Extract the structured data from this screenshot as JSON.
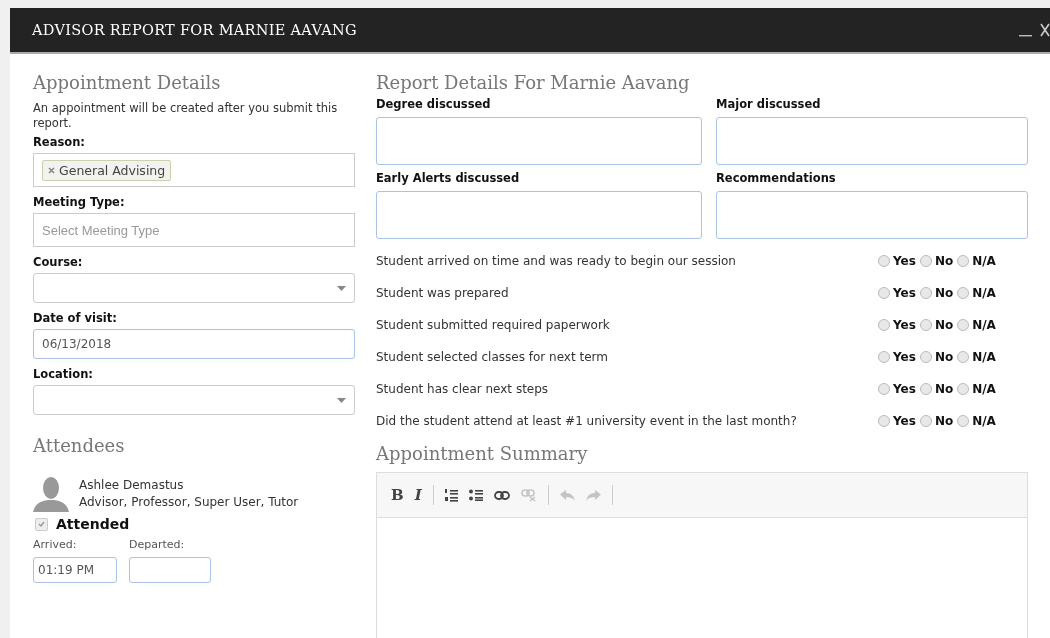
{
  "window": {
    "title": "ADVISOR REPORT FOR MARNIE AAVANG"
  },
  "appointment_details": {
    "heading": "Appointment Details",
    "note": "An appointment will be created after you submit this report.",
    "fields": [
      {
        "kind": "tags",
        "label": "Reason:",
        "tags": [
          "General Advising"
        ]
      },
      {
        "kind": "text",
        "label": "Meeting Type:",
        "placeholder": "Select Meeting Type"
      },
      {
        "kind": "select",
        "label": "Course:"
      },
      {
        "kind": "date",
        "label": "Date of visit:",
        "value": "06/13/2018"
      },
      {
        "kind": "select",
        "label": "Location:"
      }
    ]
  },
  "attendees": {
    "heading": "Attendees",
    "people": [
      {
        "name": "Ashlee Demastus",
        "roles": "Advisor, Professor, Super User, Tutor",
        "attended_label": "Attended",
        "attended": true,
        "arrived_label": "Arrived:",
        "arrived": "01:19 PM",
        "departed_label": "Departed:"
      }
    ]
  },
  "report_details": {
    "heading": "Report Details For Marnie Aavang",
    "text_fields": [
      {
        "label": "Degree discussed"
      },
      {
        "label": "Major discussed"
      },
      {
        "label": "Early Alerts discussed"
      },
      {
        "label": "Recommendations"
      }
    ],
    "questions": [
      {
        "text": "Student arrived on time and was ready to begin our session",
        "options": [
          {
            "label": "Yes",
            "selected": false
          },
          {
            "label": "No",
            "selected": false
          },
          {
            "label": "N/A",
            "selected": false
          }
        ]
      },
      {
        "text": "Student was prepared",
        "options": [
          {
            "label": "Yes",
            "selected": false
          },
          {
            "label": "No",
            "selected": false
          },
          {
            "label": "N/A",
            "selected": false
          }
        ]
      },
      {
        "text": "Student submitted required paperwork",
        "options": [
          {
            "label": "Yes",
            "selected": false
          },
          {
            "label": "No",
            "selected": false
          },
          {
            "label": "N/A",
            "selected": false
          }
        ]
      },
      {
        "text": "Student selected classes for next term",
        "options": [
          {
            "label": "Yes",
            "selected": false
          },
          {
            "label": "No",
            "selected": false
          },
          {
            "label": "N/A",
            "selected": false
          }
        ]
      },
      {
        "text": "Student has clear next steps",
        "options": [
          {
            "label": "Yes",
            "selected": false
          },
          {
            "label": "No",
            "selected": false
          },
          {
            "label": "N/A",
            "selected": false
          }
        ]
      },
      {
        "text": "Did the student attend at least #1 university event in the last month?",
        "options": [
          {
            "label": "Yes",
            "selected": false
          },
          {
            "label": "No",
            "selected": false
          },
          {
            "label": "N/A",
            "selected": false
          }
        ]
      }
    ]
  },
  "summary": {
    "heading": "Appointment Summary",
    "toolbar": [
      {
        "kind": "bold",
        "label": "B",
        "disabled": false
      },
      {
        "kind": "italic",
        "label": "I",
        "disabled": false
      },
      {
        "kind": "separator"
      },
      {
        "kind": "numbered-list",
        "disabled": false
      },
      {
        "kind": "bullet-list",
        "disabled": false
      },
      {
        "kind": "link",
        "disabled": false
      },
      {
        "kind": "unlink",
        "disabled": true
      },
      {
        "kind": "separator"
      },
      {
        "kind": "undo",
        "disabled": true
      },
      {
        "kind": "redo",
        "disabled": true
      },
      {
        "kind": "separator"
      }
    ]
  }
}
